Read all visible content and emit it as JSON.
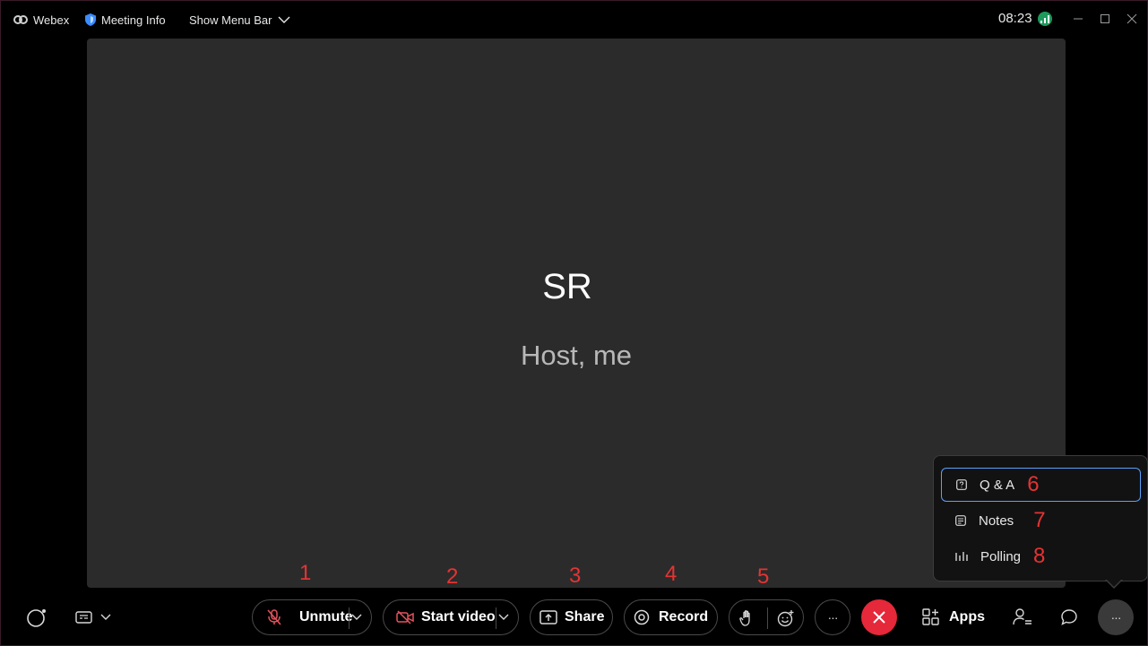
{
  "titlebar": {
    "app_name": "Webex",
    "meeting_info": "Meeting Info",
    "show_menu_bar": "Show Menu Bar",
    "clock": "08:23"
  },
  "stage": {
    "initials": "SR",
    "participant_label": "Host, me"
  },
  "annotations": [
    "1",
    "2",
    "3",
    "4",
    "5",
    "6",
    "7",
    "8"
  ],
  "controls": {
    "unmute": "Unmute",
    "start_video": "Start video",
    "share": "Share",
    "record": "Record",
    "more": "···",
    "apps": "Apps",
    "more_options": "···"
  },
  "popup": {
    "items": [
      {
        "label": "Q & A",
        "selected": true
      },
      {
        "label": "Notes",
        "selected": false
      },
      {
        "label": "Polling",
        "selected": false
      }
    ]
  },
  "colors": {
    "end_call": "#e5283a",
    "annotation": "#e53333",
    "stage": "#2b2b2b",
    "selected_outline": "#5aa0ff",
    "mic_off": "#e5535e"
  }
}
